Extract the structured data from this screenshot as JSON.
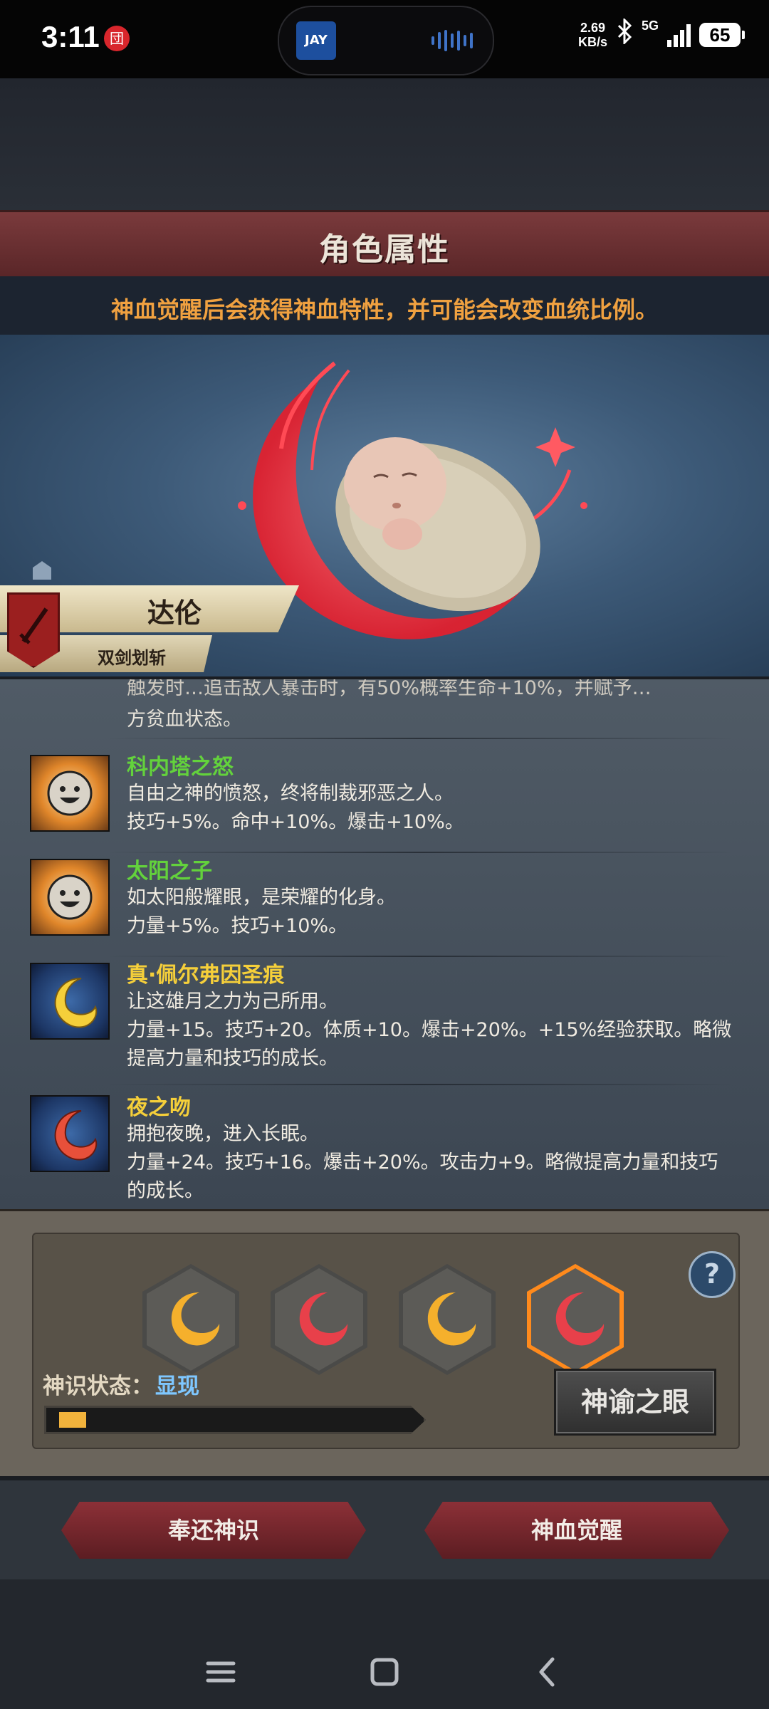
{
  "status_bar": {
    "time": "3:11",
    "notification_badge": "団",
    "app_icon_label": "JAY",
    "net_speed_value": "2.69",
    "net_speed_unit": "KB/s",
    "network": "5G",
    "battery": "65"
  },
  "header": {
    "title": "角色属性",
    "subtitle": "神血觉醒后会获得神血特性，并可能会改变血统比例。"
  },
  "character": {
    "name": "达伦",
    "class": "双剑划斩"
  },
  "traits_clipped": {
    "line1": "触发时…追击敌人暴击时，有50%概率生命+10%，并赋予…",
    "line2": "方贫血状态。"
  },
  "traits": [
    {
      "name": "科内塔之怒",
      "name_color": "#63d23c",
      "icon": "smiling-sun-icon",
      "desc": "自由之神的愤怒，终将制裁邪恶之人。",
      "effects": [
        "技巧+5%。命中+10%。爆击+10%。"
      ]
    },
    {
      "name": "太阳之子",
      "name_color": "#63d23c",
      "icon": "smiling-sun-icon",
      "desc": "如太阳般耀眼，是荣耀的化身。",
      "effects": [
        "力量+5%。技巧+10%。"
      ]
    },
    {
      "name": "真·佩尔弗因圣痕",
      "name_color": "#f5cf3a",
      "icon": "golden-crescent-icon",
      "desc": "让这雄月之力为己所用。",
      "effects": [
        "力量+15。技巧+20。体质+10。爆击+20%。+15%经验获取。略微",
        "提高力量和技巧的成长。"
      ]
    },
    {
      "name": "夜之吻",
      "name_color": "#f5cf3a",
      "icon": "red-crescent-icon",
      "desc": "拥抱夜晚，进入长眠。",
      "effects": [
        "力量+24。技巧+16。爆击+20%。攻击力+9。略微提高力量和技巧",
        "的成长。"
      ]
    }
  ],
  "bloodline_slots": [
    {
      "icon": "gold-moon-icon",
      "color": "#f5b02c",
      "active": false
    },
    {
      "icon": "red-moon-icon",
      "color": "#e8404a",
      "active": false
    },
    {
      "icon": "gold-moon-icon",
      "color": "#f5b02c",
      "active": false
    },
    {
      "icon": "red-moon-icon",
      "color": "#e8404a",
      "active": true
    }
  ],
  "panel": {
    "help_icon": "?",
    "state_label": "神识状态：",
    "state_value": "显现",
    "progress": 0.08,
    "oracle_button": "神谕之眼"
  },
  "actions": {
    "return_button": "奉还神识",
    "awaken_button": "神血觉醒"
  },
  "colors": {
    "accent_orange": "#f0a140",
    "title_red": "#7a3a3c",
    "state_blue": "#7ec7ff"
  }
}
